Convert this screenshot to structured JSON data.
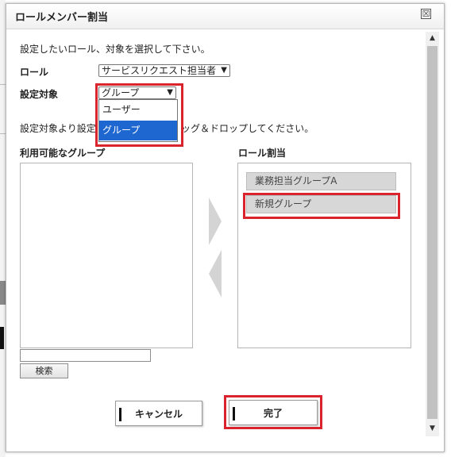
{
  "dialog": {
    "title": "ロールメンバー割当",
    "close_icon": "☒"
  },
  "instructions": "設定したいロール、対象を選択して下さい。",
  "role": {
    "label": "ロール",
    "selected": "サービスリクエスト担当者"
  },
  "target": {
    "label": "設定対象",
    "selected": "グループ",
    "options": [
      "ユーザー",
      "グループ"
    ],
    "highlighted_option": "グループ"
  },
  "drag_hint": {
    "left": "設定対象より設定",
    "right": "ッグ＆ドロップしてください。"
  },
  "available": {
    "header": "利用可能なグループ",
    "items": [],
    "search_value": "",
    "search_button": "検索"
  },
  "assigned": {
    "header": "ロール割当",
    "items": [
      "業務担当グループA",
      "新規グループ"
    ]
  },
  "buttons": {
    "cancel": "キャンセル",
    "done": "完了"
  },
  "colors": {
    "highlight_red": "#d9232d",
    "selected_option_blue": "#1e66d0"
  }
}
